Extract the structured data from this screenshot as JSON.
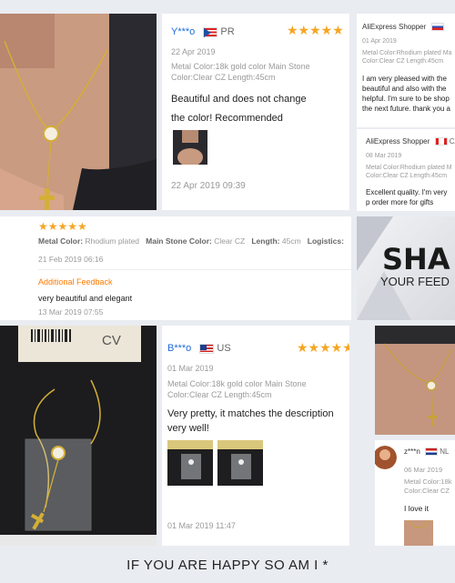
{
  "colors": {
    "accent_star": "#f5a623",
    "username": "#1e6bd6",
    "additional": "#ff7a00",
    "bg": "#e9ecf1"
  },
  "review1": {
    "user": "Y***o",
    "country": "PR",
    "date_top": "22 Apr 2019",
    "specs": "Metal Color:18k gold color Main Stone Color:Clear CZ Length:45cm",
    "text": "Beautiful and does not change the color! Recommended",
    "date_bottom": "22 Apr 2019 09:39",
    "stars": "★★★★★"
  },
  "review_right1": {
    "user": "AliExpress Shopper",
    "date": "01 Apr 2019",
    "specs": "Metal Color:Rhodium plated Ma Color:Clear CZ Length:45cm",
    "text": "I am very pleased with the beautiful and also with the helpful. I'm sure to be shop the next future. thank you a"
  },
  "review_right2": {
    "user": "AliExpress Shopper",
    "country": "CA",
    "date": "08 Mar 2019",
    "specs": "Metal Color:Rhodium plated M Color:Clear CZ Length:45cm",
    "text": "Excellent quality. I'm very p order more for gifts"
  },
  "review2": {
    "stars": "★★★★★",
    "metal_label": "Metal Color:",
    "metal_value": "Rhodium plated",
    "stone_label": "Main Stone Color:",
    "stone_value": "Clear CZ",
    "length_label": "Length:",
    "length_value": "45cm",
    "logistics_label": "Logistics:",
    "date": "21 Feb 2019 06:16",
    "additional_label": "Additional Feedback",
    "additional_text": "very beautiful and elegant",
    "additional_date": "13 Mar 2019 07:55"
  },
  "share_banner": {
    "title": "SHA",
    "subtitle": "YOUR FEED"
  },
  "package_label": {
    "line": "CV"
  },
  "review3": {
    "user": "B***o",
    "country": "US",
    "date_top": "01 Mar 2019",
    "specs": "Metal Color:18k gold color Main Stone Color:Clear CZ Length:45cm",
    "text": "Very pretty, it matches the description very well!",
    "date_bottom": "01 Mar 2019 11:47",
    "stars": "★★★★★"
  },
  "review_right3": {
    "user": "z***n",
    "country": "NL",
    "date": "06 Mar 2019",
    "specs": "Metal Color:18k Color:Clear CZ",
    "text": "I love it"
  },
  "footer": {
    "text": "IF YOU ARE HAPPY SO AM I *"
  }
}
